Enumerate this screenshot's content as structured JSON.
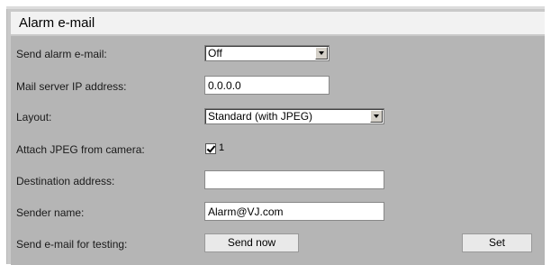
{
  "section": {
    "title": "Alarm e-mail"
  },
  "fields": {
    "send_alarm_email": {
      "label": "Send alarm e-mail:",
      "value": "Off"
    },
    "mail_server_ip": {
      "label": "Mail server IP address:",
      "value": "0.0.0.0"
    },
    "layout": {
      "label": "Layout:",
      "value": "Standard (with JPEG)"
    },
    "attach_jpeg": {
      "label": "Attach JPEG from camera:",
      "checked": true,
      "option_label": "1"
    },
    "destination_address": {
      "label": "Destination address:",
      "value": ""
    },
    "sender_name": {
      "label": "Sender name:",
      "value": "Alarm@VJ.com"
    },
    "test_email": {
      "label": "Send e-mail for testing:",
      "button_label": "Send now"
    }
  },
  "actions": {
    "set_label": "Set"
  },
  "colors": {
    "panel_bg": "#b5b5b5",
    "title_bg": "#f2f2f2"
  }
}
